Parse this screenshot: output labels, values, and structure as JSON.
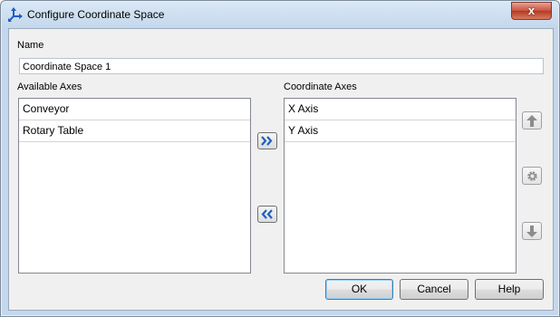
{
  "window": {
    "title": "Configure Coordinate Space",
    "close_label": "x"
  },
  "name_field": {
    "label": "Name",
    "value": "Coordinate Space 1"
  },
  "available": {
    "label": "Available Axes",
    "items": [
      "Conveyor",
      "Rotary Table"
    ]
  },
  "coordinate": {
    "label": "Coordinate Axes",
    "items": [
      "X Axis",
      "Y Axis"
    ]
  },
  "buttons": {
    "ok": "OK",
    "cancel": "Cancel",
    "help": "Help"
  },
  "icons": {
    "app": "axes-icon",
    "add": "double-chevron-right-icon",
    "remove": "double-chevron-left-icon",
    "up": "arrow-up-icon",
    "settings": "gear-icon",
    "down": "arrow-down-icon"
  },
  "colors": {
    "accent": "#1f5fbf",
    "title_gradient_top": "#dbe8f5",
    "close": "#c9523c"
  }
}
